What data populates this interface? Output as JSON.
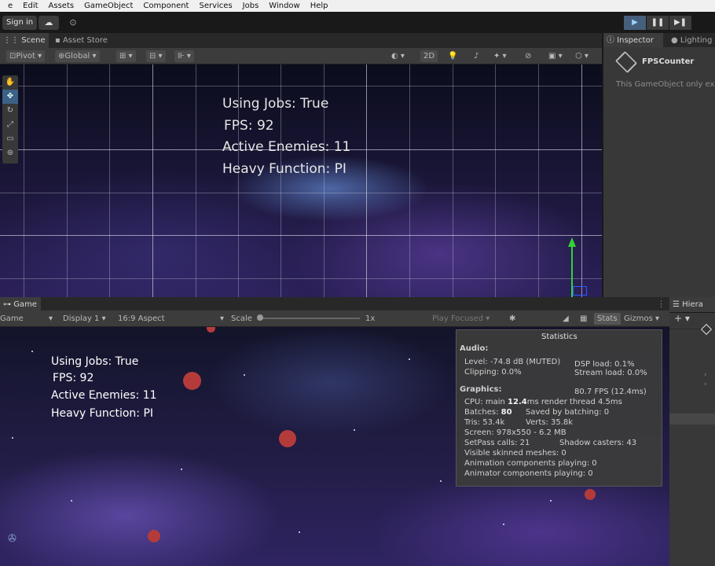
{
  "menu": [
    "e",
    "Edit",
    "Assets",
    "GameObject",
    "Component",
    "Services",
    "Jobs",
    "Window",
    "Help"
  ],
  "toolbar": {
    "signin": "Sign in",
    "cloud_icon": "cloud-icon",
    "collab_icon": "collab-icon"
  },
  "scene_tabs": {
    "scene": "Scene",
    "asset_store": "Asset Store"
  },
  "scene_toolbar": {
    "pivot": "Pivot",
    "global": "Global",
    "mode_2d": "2D"
  },
  "scene_text": {
    "line1": "Using Jobs: True",
    "line2": "FPS: 92",
    "line3": "Active Enemies: 11",
    "line4": "Heavy Function: PI"
  },
  "inspector": {
    "tab": "Inspector",
    "lighting_tab": "Lighting",
    "object_name": "FPSCounter",
    "note": "This GameObject only ex"
  },
  "game_tabs": {
    "game": "Game",
    "hierarchy": "Hiera"
  },
  "game_toolbar": {
    "mode": "Game",
    "display": "Display 1",
    "aspect": "16:9 Aspect",
    "scale_label": "Scale",
    "scale_value": "1x",
    "play_focused": "Play Focused",
    "stats": "Stats",
    "gizmos": "Gizmos"
  },
  "game_text": {
    "line1": "Using Jobs: True",
    "line2": "FPS: 92",
    "line3": "Active Enemies: 11",
    "line4": "Heavy Function: PI"
  },
  "stats": {
    "title": "Statistics",
    "audio_header": "Audio:",
    "level": "Level: -74.8 dB (MUTED)",
    "dsp": "DSP load: 0.1%",
    "clipping": "Clipping: 0.0%",
    "stream": "Stream load: 0.0%",
    "graphics_header": "Graphics:",
    "fps": "80.7 FPS (12.4ms)",
    "cpu_prefix": "CPU: main ",
    "cpu_main": "12.4",
    "cpu_suffix": "ms  render thread 4.5ms",
    "batches_prefix": "Batches: ",
    "batches": "80",
    "saved": "Saved by batching: 0",
    "tris": "Tris: 53.4k",
    "verts": "Verts: 35.8k",
    "screen": "Screen: 978x550 - 6.2 MB",
    "setpass": "SetPass calls: 21",
    "shadow": "Shadow casters: 43",
    "skinned": "Visible skinned meshes: 0",
    "anim": "Animation components playing: 0",
    "animator": "Animator components playing: 0"
  }
}
